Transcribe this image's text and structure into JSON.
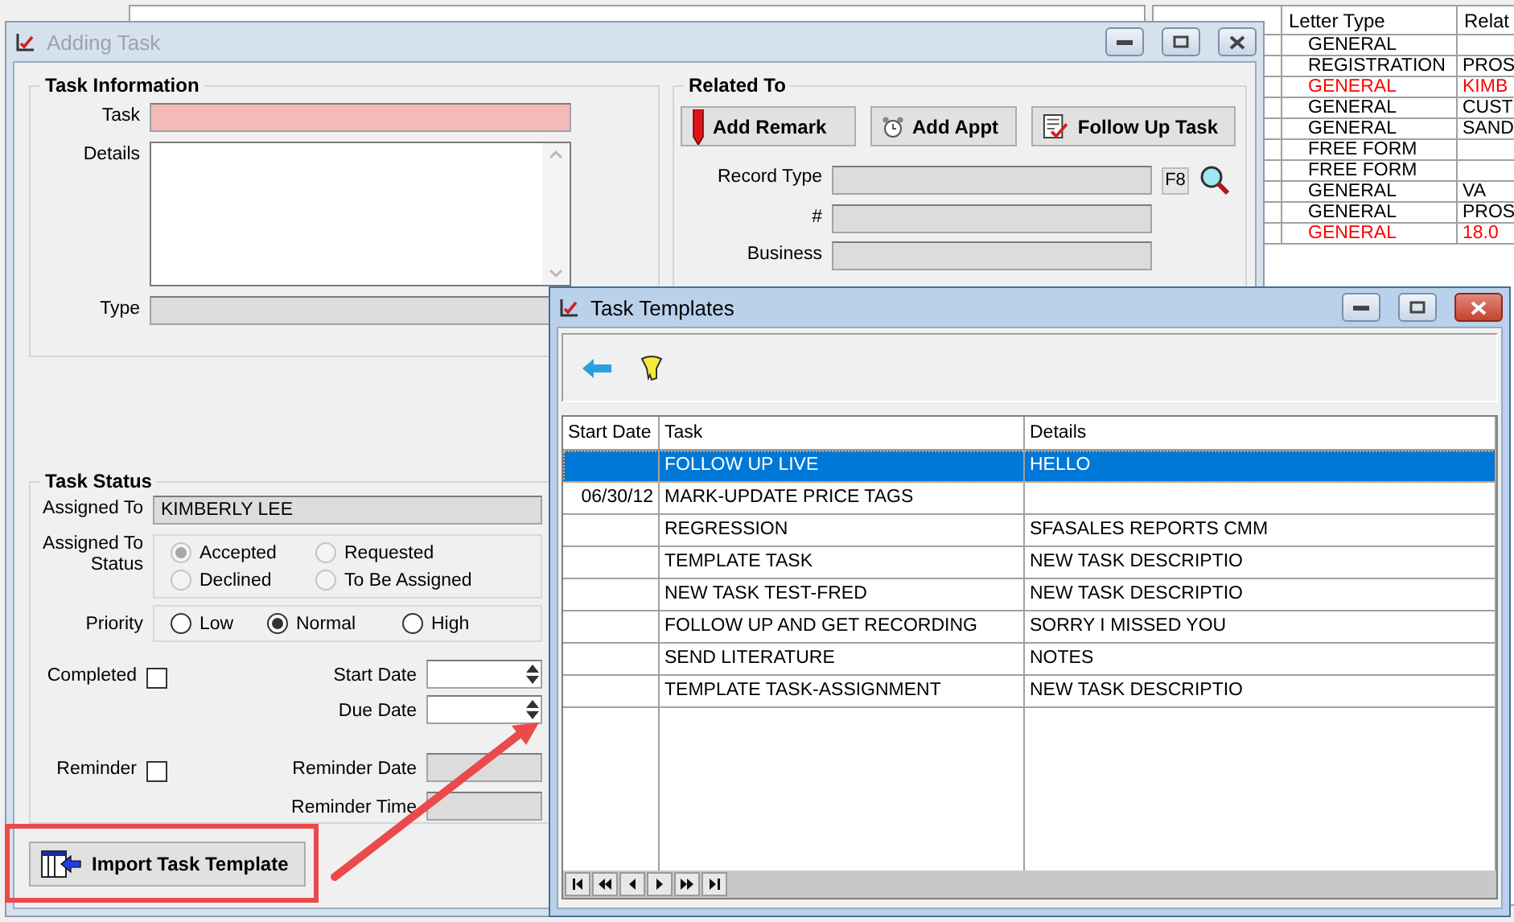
{
  "background": {
    "letters": {
      "columns": [
        "Letter Type",
        "Relat"
      ],
      "rows": [
        {
          "letter_type": "GENERAL",
          "color": "#000000"
        },
        {
          "letter_type": "REGISTRATION",
          "related": "PROS",
          "color": "#000000"
        },
        {
          "letter_type": "GENERAL",
          "related": "KIMB",
          "color": "#ff0000"
        },
        {
          "letter_type": "GENERAL",
          "related": "CUST",
          "color": "#000000"
        },
        {
          "letter_type": "GENERAL",
          "related": "SAND",
          "color": "#000000"
        },
        {
          "letter_type": "FREE FORM",
          "color": "#000000"
        },
        {
          "letter_type": "FREE FORM",
          "color": "#000000"
        },
        {
          "letter_type": "GENERAL",
          "related": "VA",
          "color": "#000000"
        },
        {
          "letter_type": "GENERAL",
          "related": "PROS",
          "color": "#000000"
        },
        {
          "letter_type": "GENERAL",
          "related": "18.0",
          "color": "#ff0000"
        }
      ]
    }
  },
  "adding_task": {
    "title": "Adding Task",
    "active": false,
    "task_information": {
      "title": "Task Information",
      "fields": [
        {
          "label": "Task",
          "kind": "text",
          "required": true,
          "disabled": false
        },
        {
          "label": "Details",
          "kind": "memo",
          "required": false,
          "disabled": false
        },
        {
          "label": "Type",
          "kind": "text",
          "disabled": true
        }
      ]
    },
    "related_to": {
      "title": "Related To",
      "buttons": [
        {
          "label": "Add Remark",
          "kind": "pencil"
        },
        {
          "label": "Add Appt",
          "kind": "clock"
        },
        {
          "label": "Follow Up Task",
          "kind": "checklist"
        }
      ],
      "lookup_key": "F8",
      "fields": [
        {
          "label": "Record Type",
          "kind": "lookup",
          "disabled": true
        },
        {
          "label": "#",
          "kind": "text",
          "disabled": true
        },
        {
          "label": "Business",
          "kind": "text",
          "disabled": true
        }
      ]
    },
    "task_status": {
      "title": "Task Status",
      "assigned_to": {
        "label": "Assigned To",
        "value": "KIMBERLY LEE"
      },
      "status": {
        "label": "Assigned To Status",
        "disabled": true,
        "options": [
          {
            "label": "Accepted",
            "selected": true
          },
          {
            "label": "Requested",
            "selected": false
          },
          {
            "label": "Declined",
            "selected": false
          },
          {
            "label": "To Be Assigned",
            "selected": false
          }
        ]
      },
      "priority": {
        "label": "Priority",
        "disabled": false,
        "options": [
          {
            "label": "Low",
            "selected": false
          },
          {
            "label": "Normal",
            "selected": true
          },
          {
            "label": "High",
            "selected": false
          }
        ]
      },
      "completed": {
        "label": "Completed",
        "checked": false
      },
      "reminder": {
        "label": "Reminder",
        "checked": false
      },
      "dates": [
        {
          "label": "Start Date",
          "disabled": false
        },
        {
          "label": "Due Date",
          "disabled": false
        },
        {
          "label": "Reminder Date",
          "disabled": true
        },
        {
          "label": "Reminder Time",
          "disabled": true
        }
      ]
    },
    "import_button": "Import Task Template"
  },
  "task_templates": {
    "title": "Task Templates",
    "active": true,
    "columns": [
      "Start Date",
      "Task",
      "Details"
    ],
    "rows": [
      {
        "task": "FOLLOW UP LIVE",
        "details": "HELLO",
        "selected": true
      },
      {
        "start_date": "06/30/12",
        "task": "MARK-UPDATE PRICE TAGS",
        "selected": false
      },
      {
        "task": "REGRESSION",
        "details": "SFASALES REPORTS CMM",
        "selected": false
      },
      {
        "task": "TEMPLATE TASK",
        "details": "NEW TASK DESCRIPTIO",
        "selected": false
      },
      {
        "task": "NEW TASK TEST-FRED",
        "details": "NEW TASK DESCRIPTIO",
        "selected": false
      },
      {
        "task": "FOLLOW UP AND GET RECORDING",
        "details": "SORRY I MISSED YOU",
        "selected": false
      },
      {
        "task": "SEND LITERATURE",
        "details": "NOTES",
        "selected": false
      },
      {
        "task": "TEMPLATE TASK-ASSIGNMENT",
        "details": "NEW TASK DESCRIPTIO",
        "selected": false
      }
    ]
  }
}
